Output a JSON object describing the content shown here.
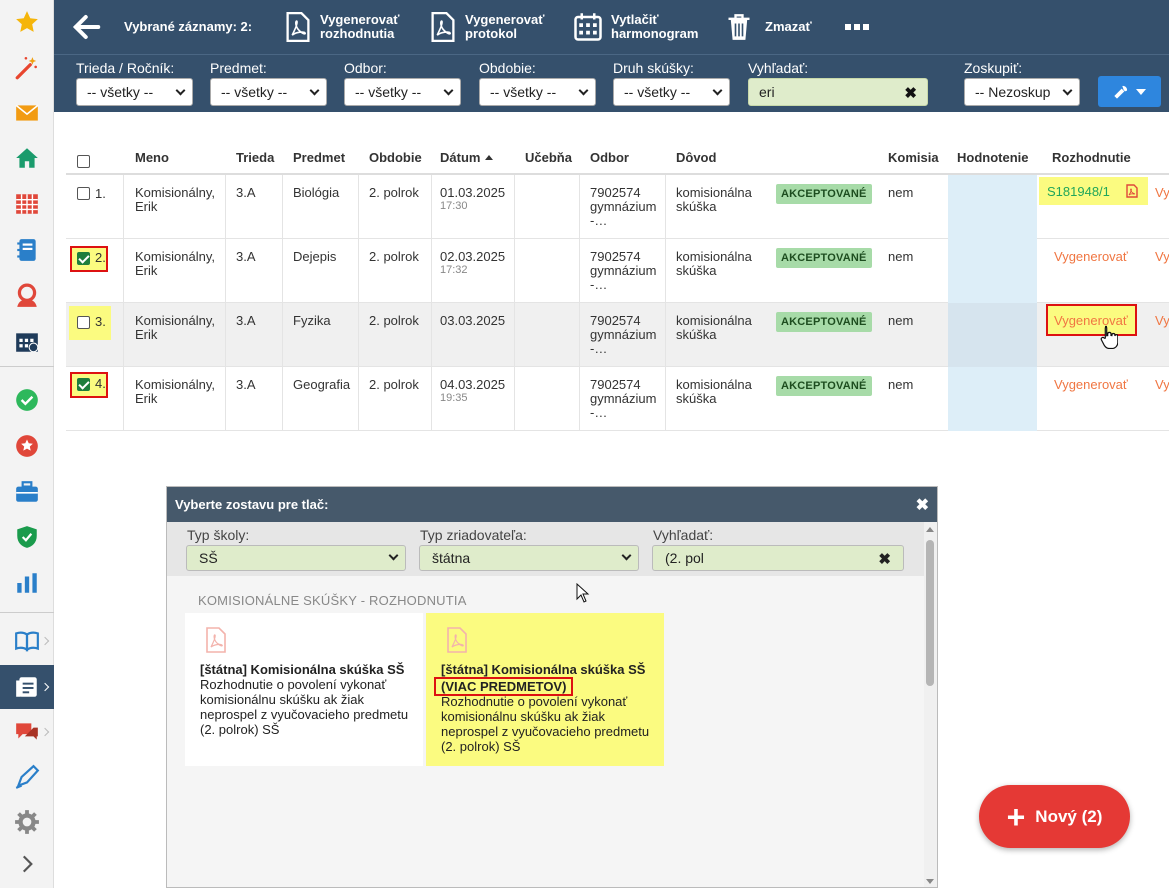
{
  "toolbar": {
    "selected_label": "Vybrané záznamy: 2:",
    "generate_decisions": "Vygenerovať\nrozhodnutia",
    "generate_protocol": "Vygenerovať\nprotokol",
    "print_schedule": "Vytlačiť\nharmonogram",
    "delete": "Zmazať"
  },
  "filters": {
    "class_label": "Trieda / Ročník:",
    "class_value": "-- všetky --",
    "subject_label": "Predmet:",
    "subject_value": "-- všetky --",
    "field_label": "Odbor:",
    "field_value": "-- všetky --",
    "period_label": "Obdobie:",
    "period_value": "-- všetky --",
    "exam_type_label": "Druh skúšky:",
    "exam_type_value": "-- všetky --",
    "search_label": "Vyhľadať:",
    "search_value": "eri",
    "group_label": "Zoskupiť:",
    "group_value": "-- Nezoskup"
  },
  "table": {
    "headers": {
      "name": "Meno",
      "class": "Trieda",
      "subject": "Predmet",
      "period": "Obdobie",
      "date": "Dátum",
      "room": "Učebňa",
      "field": "Odbor",
      "reason": "Dôvod",
      "commission": "Komisia",
      "grade": "Hodnotenie",
      "decision": "Rozhodnutie"
    },
    "rows": [
      {
        "num": "1.",
        "checked": false,
        "name1": "Komisionálny,",
        "name2": "Erik",
        "class": "3.A",
        "subject": "Biológia",
        "period": "2. polrok",
        "date": "01.03.2025",
        "time": "17:30",
        "field1": "7902574",
        "field2": "gymnázium",
        "field3": "-…",
        "reason1": "komisionálna",
        "reason2": "skúška",
        "status": "AKCEPTOVANÉ",
        "commission": "nem",
        "decision": "S181948/1",
        "extra": "Vy"
      },
      {
        "num": "2.",
        "checked": true,
        "name1": "Komisionálny,",
        "name2": "Erik",
        "class": "3.A",
        "subject": "Dejepis",
        "period": "2. polrok",
        "date": "02.03.2025",
        "time": "17:32",
        "field1": "7902574",
        "field2": "gymnázium",
        "field3": "-…",
        "reason1": "komisionálna",
        "reason2": "skúška",
        "status": "AKCEPTOVANÉ",
        "commission": "nem",
        "decision": "Vygenerovať",
        "extra": "Vy"
      },
      {
        "num": "3.",
        "checked": false,
        "name1": "Komisionálny,",
        "name2": "Erik",
        "class": "3.A",
        "subject": "Fyzika",
        "period": "2. polrok",
        "date": "03.03.2025",
        "time": "",
        "field1": "7902574",
        "field2": "gymnázium",
        "field3": "-…",
        "reason1": "komisionálna",
        "reason2": "skúška",
        "status": "AKCEPTOVANÉ",
        "commission": "nem",
        "decision": "Vygenerovať",
        "extra": "Vy"
      },
      {
        "num": "4.",
        "checked": true,
        "name1": "Komisionálny,",
        "name2": "Erik",
        "class": "3.A",
        "subject": "Geografia",
        "period": "2. polrok",
        "date": "04.03.2025",
        "time": "19:35",
        "field1": "7902574",
        "field2": "gymnázium",
        "field3": "-…",
        "reason1": "komisionálna",
        "reason2": "skúška",
        "status": "AKCEPTOVANÉ",
        "commission": "nem",
        "decision": "Vygenerovať",
        "extra": "Vy"
      }
    ]
  },
  "modal": {
    "title": "Vyberte zostavu pre tlač:",
    "school_type_label": "Typ školy:",
    "school_type_value": "SŠ",
    "founder_label": "Typ zriadovateľa:",
    "founder_value": "štátna",
    "search_label": "Vyhľadať:",
    "search_value": "(2. pol",
    "section_title": "KOMISIONÁLNE SKÚŠKY - ROZHODNUTIA",
    "cards": [
      {
        "title": "[štátna] Komisionálna skúška SŠ",
        "subtitle": "",
        "desc": "Rozhodnutie o povolení vykonať komisionálnu skúšku ak žiak neprospel z vyučovacieho predmetu (2. polrok) SŠ"
      },
      {
        "title": "[štátna] Komisionálna skúška SŠ",
        "subtitle": "(VIAC PREDMETOV)",
        "desc": "Rozhodnutie o povolení vykonať komisionálnu skúšku ak žiak neprospel z vyučovacieho predmetu (2. polrok) SŠ"
      }
    ]
  },
  "fab": {
    "label": "Nový (2)"
  },
  "colors": {
    "header": "#35506c",
    "accent": "#2e86de",
    "fab": "#e53935",
    "highlight": "#fbfb80",
    "status_bg": "#a7dba8",
    "generate": "#f07642"
  },
  "icons": [
    "star-icon",
    "magic-wand-icon",
    "envelope-icon",
    "home-icon",
    "calendar-grid-icon",
    "notebook-icon",
    "person-icon",
    "timetable-icon",
    "check-circle-icon",
    "star-badge-icon",
    "briefcase-icon",
    "shield-icon",
    "bar-chart-icon",
    "open-book-icon",
    "document-icon",
    "chat-icon",
    "pen-icon",
    "gear-icon",
    "chevron-right-icon"
  ]
}
